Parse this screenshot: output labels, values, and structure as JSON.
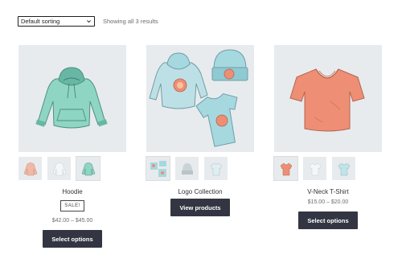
{
  "toolbar": {
    "sort_value": "Default sorting",
    "result_count": "Showing all 3 results"
  },
  "products": [
    {
      "title": "Hoodie",
      "badge": "SALE!",
      "price": "$42.00 – $45.00",
      "button": "Select options",
      "colors": {
        "garment": "#8fd5c4",
        "shade": "#67b7a4"
      }
    },
    {
      "title": "Logo Collection",
      "price": "",
      "button": "View products",
      "colors": {
        "garment": "#a6d8df",
        "shade": "#7fbcc4"
      }
    },
    {
      "title": "V-Neck T-Shirt",
      "price": "$15.00 – $20.00",
      "button": "Select options",
      "colors": {
        "garment": "#ee8e75",
        "shade": "#cf6b52"
      }
    }
  ],
  "icons": {
    "sort_chevron": "chevron-down-icon"
  },
  "theme": {
    "image_bg": "#e7ebee",
    "button_bg": "#333642",
    "text": "#43454b",
    "muted": "#6d6d6d"
  }
}
